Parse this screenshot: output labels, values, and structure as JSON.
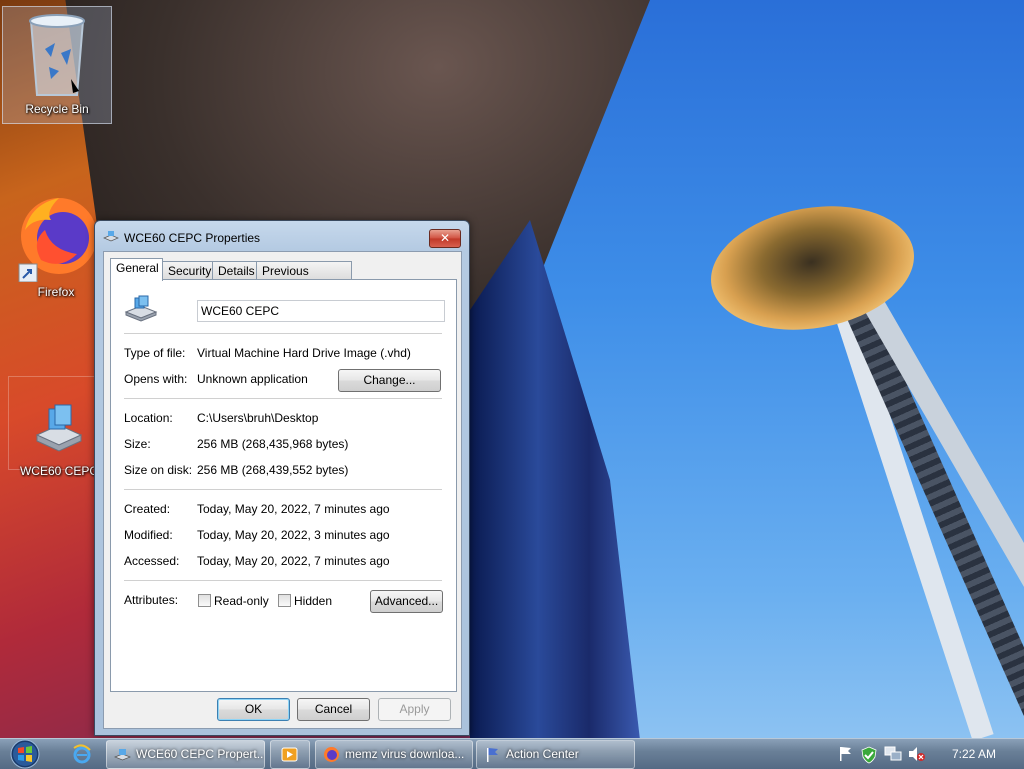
{
  "desktop": {
    "icons": [
      {
        "label": "Recycle Bin"
      },
      {
        "label": "Firefox"
      },
      {
        "label": "WCE60 CEPC"
      }
    ]
  },
  "dialog": {
    "title": "WCE60 CEPC Properties",
    "close_label": "✕",
    "tabs": [
      {
        "label": "General",
        "active": true
      },
      {
        "label": "Security"
      },
      {
        "label": "Details"
      },
      {
        "label": "Previous Versions"
      }
    ],
    "file_name": "WCE60 CEPC",
    "type_label": "Type of file:",
    "type_value": "Virtual Machine Hard Drive Image (.vhd)",
    "opens_label": "Opens with:",
    "opens_value": "Unknown application",
    "change_button": "Change...",
    "location_label": "Location:",
    "location_value": "C:\\Users\\bruh\\Desktop",
    "size_label": "Size:",
    "size_value": "256 MB (268,435,968 bytes)",
    "size_on_disk_label": "Size on disk:",
    "size_on_disk_value": "256 MB (268,439,552 bytes)",
    "created_label": "Created:",
    "created_value": "Today, May 20, 2022, 7 minutes ago",
    "modified_label": "Modified:",
    "modified_value": "Today, May 20, 2022, 3 minutes ago",
    "accessed_label": "Accessed:",
    "accessed_value": "Today, May 20, 2022, 7 minutes ago",
    "attributes_label": "Attributes:",
    "readonly_label": "Read-only",
    "readonly_checked": false,
    "hidden_label": "Hidden",
    "hidden_checked": false,
    "advanced_button": "Advanced...",
    "ok_button": "OK",
    "cancel_button": "Cancel",
    "apply_button": "Apply"
  },
  "taskbar": {
    "buttons": [
      {
        "label": "WCE60 CEPC Propert...",
        "icon": "drive-icon",
        "active": true
      },
      {
        "label": "",
        "icon": "media-player-icon"
      },
      {
        "label": "memz virus downloa...",
        "icon": "firefox-icon"
      },
      {
        "label": "Action Center",
        "icon": "flag-icon"
      }
    ],
    "clock": "7:22 AM"
  },
  "colors": {
    "taskbar": "#556a84",
    "dialog_frame": "#b4cae2",
    "close_button": "#c03828",
    "default_button_border": "#3c7fb1"
  }
}
